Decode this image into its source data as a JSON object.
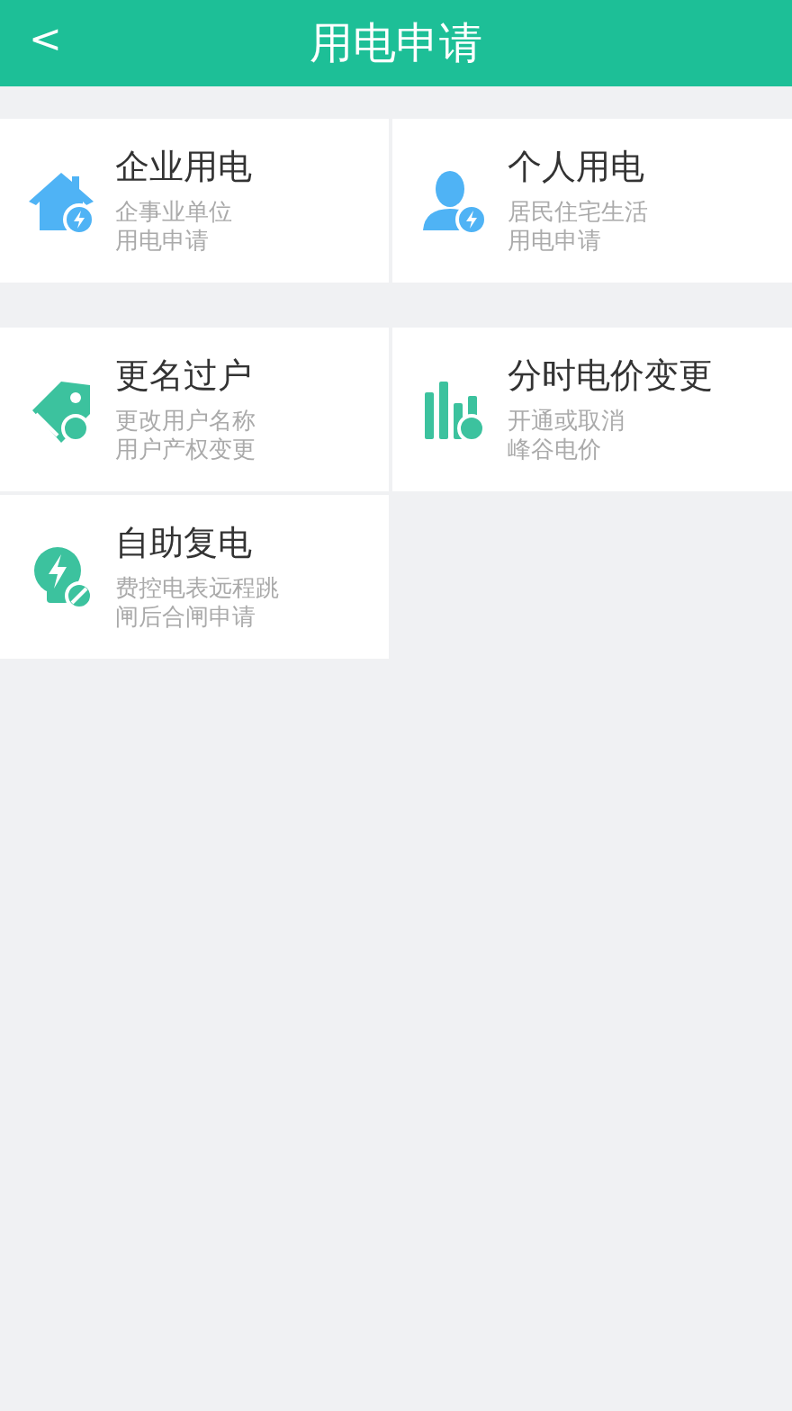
{
  "header": {
    "back": "<",
    "title": "用电申请"
  },
  "sections": [
    {
      "items": [
        {
          "title": "企业用电",
          "desc": [
            "企事业单位",
            "用电申请"
          ]
        },
        {
          "title": "个人用电",
          "desc": [
            "居民住宅生活",
            "用电申请"
          ]
        }
      ]
    },
    {
      "items": [
        {
          "title": "更名过户",
          "desc": [
            "更改用户名称",
            "用户产权变更"
          ]
        },
        {
          "title": "分时电价变更",
          "desc": [
            "开通或取消",
            "峰谷电价"
          ]
        },
        {
          "title": "自助复电",
          "desc": [
            "费控电表远程跳",
            "闸后合闸申请"
          ]
        }
      ]
    }
  ]
}
